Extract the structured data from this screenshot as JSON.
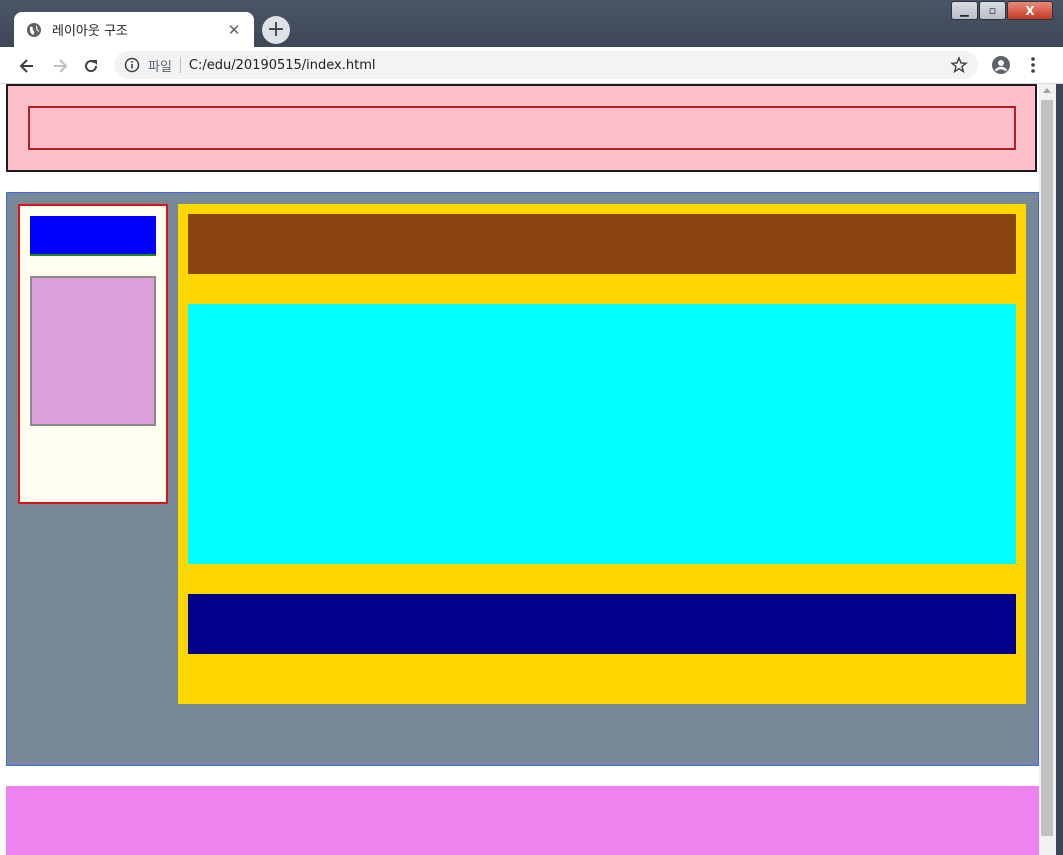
{
  "window": {
    "tab_title": "레이아웃 구조",
    "tab_close": "✕",
    "new_tab": "+",
    "controls": {
      "minimize": "▁",
      "maximize": "▫",
      "close": "X"
    }
  },
  "toolbar": {
    "scheme_label": "파일",
    "url": "C:/edu/20190515/index.html",
    "icons": [
      "back-arrow-icon",
      "forward-arrow-icon",
      "reload-icon",
      "info-icon",
      "star-icon",
      "account-icon",
      "menu-icon"
    ]
  },
  "page": {
    "blocks": [
      {
        "name": "header",
        "color": "#ffc0cb",
        "border": "#1b1b1b"
      },
      {
        "name": "header-inner",
        "border": "#b22222"
      },
      {
        "name": "container",
        "color": "#778899",
        "border": "#4169e1"
      },
      {
        "name": "aside",
        "color": "#fffff0",
        "border": "#e0101a"
      },
      {
        "name": "aside-top",
        "color": "#0000ff"
      },
      {
        "name": "aside-inner",
        "color": "#dda0dd"
      },
      {
        "name": "section",
        "color": "#ffd700"
      },
      {
        "name": "section-top",
        "color": "#8b4513"
      },
      {
        "name": "section-middle",
        "color": "#00ffff"
      },
      {
        "name": "section-bottom",
        "color": "#00008b"
      },
      {
        "name": "footer",
        "color": "#ee82ee"
      }
    ]
  }
}
